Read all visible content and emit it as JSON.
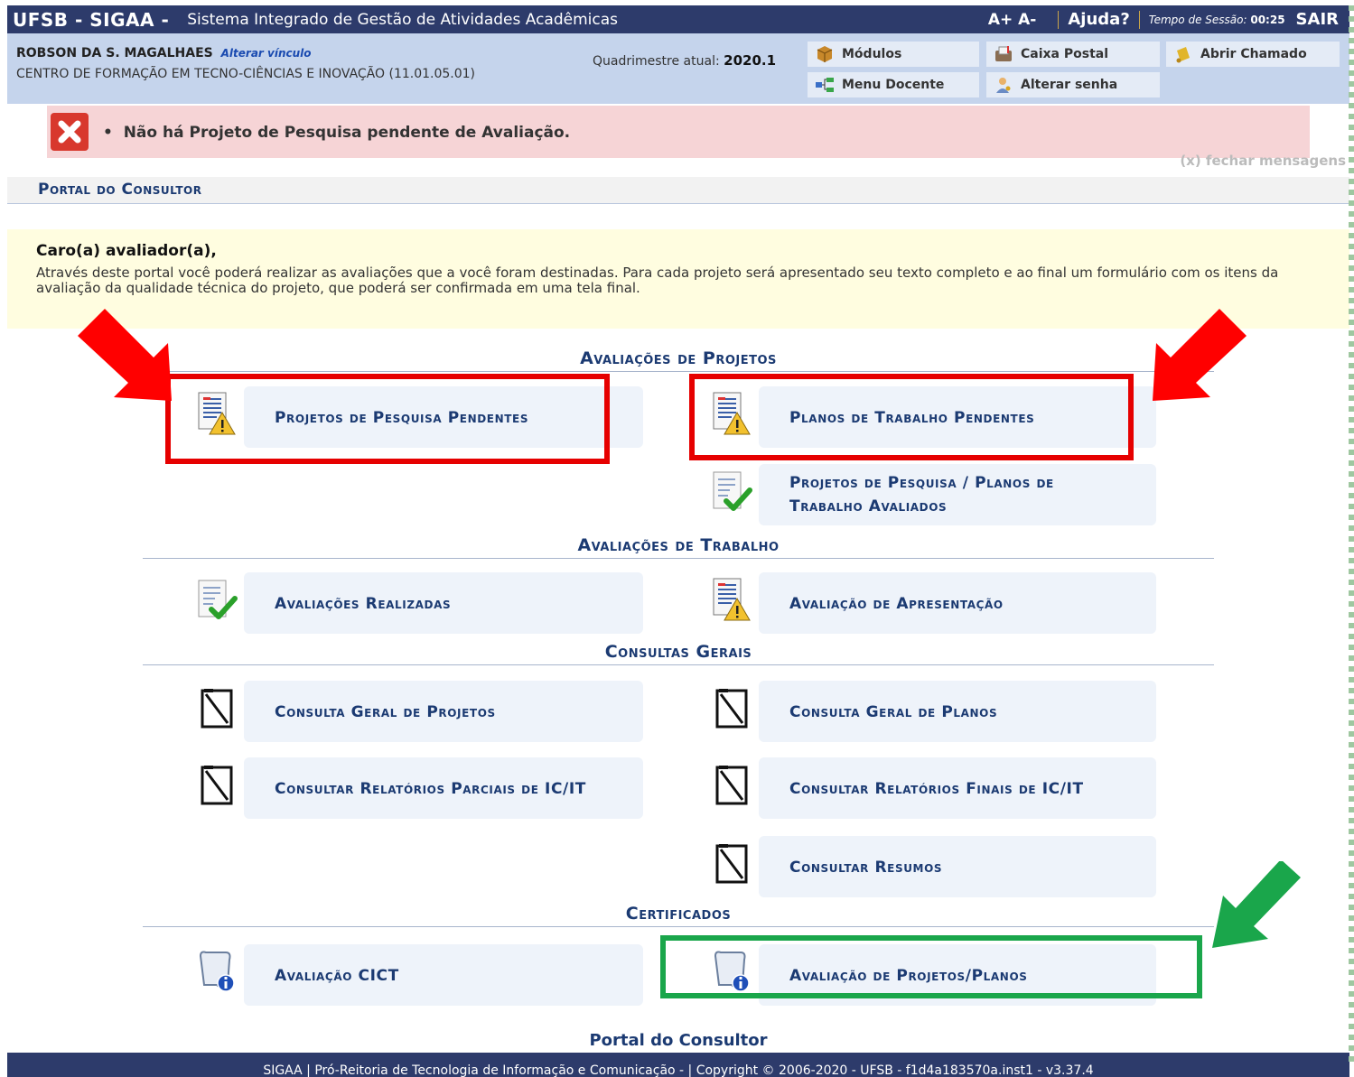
{
  "topbar": {
    "brand": "UFSB - SIGAA -",
    "system_name": "Sistema Integrado de Gestão de Atividades Acadêmicas",
    "font_controls": "A+ A-",
    "help": "Ajuda?",
    "session_label": "Tempo de Sessão:",
    "session_time": "00:25",
    "logout": "SAIR"
  },
  "user": {
    "name": "ROBSON DA S. MAGALHAES",
    "change_link": "Alterar vínculo",
    "department": "CENTRO DE FORMAÇÃO EM TECNO-CIÊNCIAS E INOVAÇÃO (11.01.05.01)",
    "quad_label": "Quadrimestre atual:",
    "quad_value": "2020.1"
  },
  "quick_buttons": {
    "modulos": "Módulos",
    "caixa_postal": "Caixa Postal",
    "abrir_chamado": "Abrir Chamado",
    "menu_docente": "Menu Docente",
    "alterar_senha": "Alterar senha"
  },
  "message": {
    "text": "Não há Projeto de Pesquisa pendente de Avaliação.",
    "close": "(x) fechar mensagens"
  },
  "portal_title": "Portal do Consultor",
  "intro": {
    "greeting": "Caro(a) avaliador(a),",
    "text": "Através deste portal você poderá realizar as avaliações que a você foram destinadas. Para cada projeto será apresentado seu texto completo e ao final um formulário com os itens da avaliação da qualidade técnica do projeto, que poderá ser confirmada em uma tela final."
  },
  "sections": {
    "avaliacoes_projetos": {
      "title": "Avaliações de Projetos",
      "projetos_pendentes": "Projetos de Pesquisa Pendentes",
      "planos_pendentes": "Planos de Trabalho Pendentes",
      "avaliados_1": "Projetos de Pesquisa / Planos de",
      "avaliados_2": "Trabalho Avaliados"
    },
    "avaliacoes_trabalho": {
      "title": "Avaliações de Trabalho",
      "realizadas": "Avaliações Realizadas",
      "apresentacao": "Avaliação de Apresentação"
    },
    "consultas": {
      "title": "Consultas Gerais",
      "projetos": "Consulta Geral de Projetos",
      "planos": "Consulta Geral de Planos",
      "parciais": "Consultar Relatórios Parciais de IC/IT",
      "finais": "Consultar Relatórios Finais de IC/IT",
      "resumos": "Consultar Resumos"
    },
    "certificados": {
      "title": "Certificados",
      "cict": "Avaliação CICT",
      "projetos_planos": "Avaliação de Projetos/Planos"
    }
  },
  "footer": {
    "title": "Portal do Consultor",
    "text": "SIGAA | Pró-Reitoria de Tecnologia de Informação e Comunicação - | Copyright © 2006-2020 - UFSB - f1d4a183570a.inst1 - v3.37.4"
  },
  "colors": {
    "highlight_red": "#e60000",
    "highlight_green": "#1aa64b",
    "header": "#2d3b6b"
  }
}
